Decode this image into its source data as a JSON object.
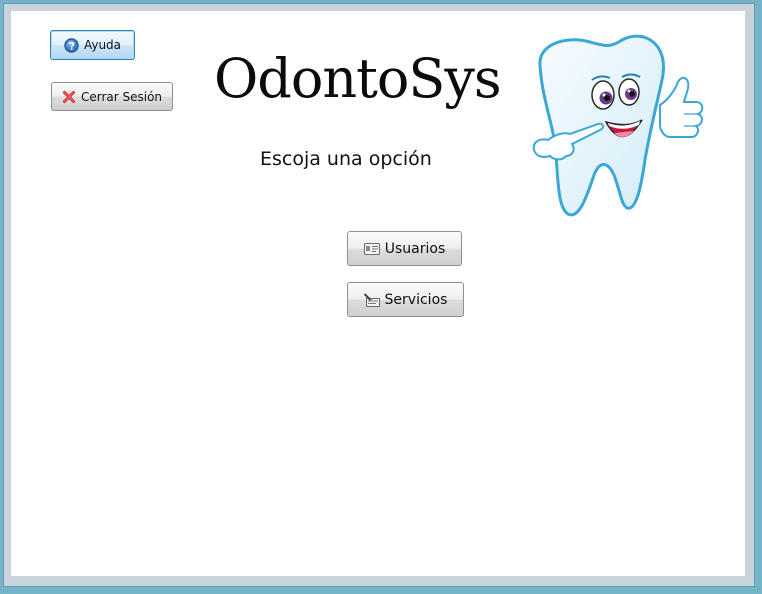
{
  "window": {
    "app_title": "OdontoSys"
  },
  "header": {
    "subtitle": "Escoja una opción"
  },
  "toolbar": {
    "help_label": "Ayuda",
    "logout_label": "Cerrar Sesión"
  },
  "menu": {
    "users_label": "Usuarios",
    "services_label": "Servicios"
  },
  "icons": {
    "help": "question-circle-icon",
    "logout": "red-x-icon",
    "users": "id-card-icon",
    "services": "pen-document-icon",
    "mascot": "tooth-mascot"
  },
  "colors": {
    "frame": "#74b3c8",
    "help_icon": "#2f6fc0",
    "logout_icon": "#d8282a",
    "tooth_outline": "#3aa7d6"
  }
}
